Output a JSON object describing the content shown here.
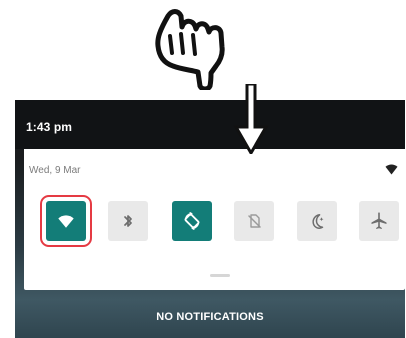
{
  "status_bar": {
    "time": "1:43 pm"
  },
  "quick_settings": {
    "date": "Wed, 9 Mar",
    "top_right_icon": "wifi-signal-icon",
    "tiles": [
      {
        "name": "wifi",
        "icon": "wifi-icon",
        "state": "on",
        "highlighted": true
      },
      {
        "name": "bluetooth",
        "icon": "bluetooth-icon",
        "state": "off"
      },
      {
        "name": "auto-rotate",
        "icon": "rotate-icon",
        "state": "on"
      },
      {
        "name": "mobile-data",
        "icon": "no-sim-icon",
        "state": "disabled"
      },
      {
        "name": "night-mode",
        "icon": "moon-icon",
        "state": "off"
      },
      {
        "name": "airplane-mode",
        "icon": "airplane-icon",
        "state": "off"
      }
    ]
  },
  "notifications": {
    "empty_label": "NO NOTIFICATIONS"
  },
  "overlay": {
    "gesture_icon": "hand-pointing-down-icon",
    "direction_icon": "arrow-down-icon"
  },
  "colors": {
    "tile_on": "#137d78",
    "tile_off": "#e9e9e9",
    "highlight": "#e53a43",
    "status_bar": "#111315"
  }
}
